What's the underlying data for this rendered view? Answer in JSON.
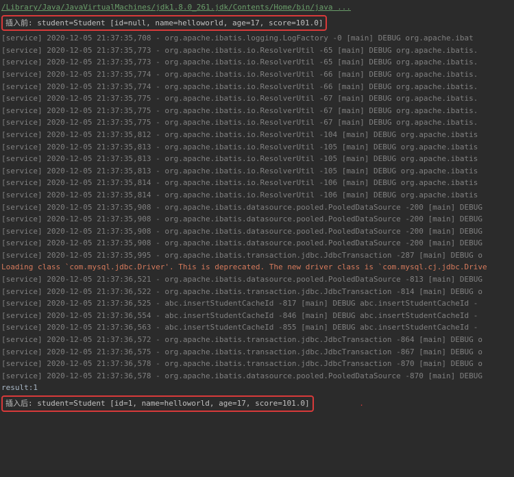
{
  "header": "/Library/Java/JavaVirtualMachines/jdk1.8.0_261.jdk/Contents/Home/bin/java ...",
  "before_insert": "插入前: student=Student [id=null, name=helloworld, age=17, score=101.0]",
  "after_insert": "插入后: student=Student [id=1, name=helloworld, age=17, score=101.0]",
  "result_text": "result:1",
  "red_dot": ".",
  "warning": "Loading class `com.mysql.jdbc.Driver'. This is deprecated. The new driver class is `com.mysql.cj.jdbc.Drive",
  "logs": [
    "[service] 2020-12-05 21:37:35,708 - org.apache.ibatis.logging.LogFactory -0    [main] DEBUG org.apache.ibat",
    "[service] 2020-12-05 21:37:35,773 - org.apache.ibatis.io.ResolverUtil -65   [main] DEBUG org.apache.ibatis.",
    "[service] 2020-12-05 21:37:35,773 - org.apache.ibatis.io.ResolverUtil -65   [main] DEBUG org.apache.ibatis.",
    "[service] 2020-12-05 21:37:35,774 - org.apache.ibatis.io.ResolverUtil -66   [main] DEBUG org.apache.ibatis.",
    "[service] 2020-12-05 21:37:35,774 - org.apache.ibatis.io.ResolverUtil -66   [main] DEBUG org.apache.ibatis.",
    "[service] 2020-12-05 21:37:35,775 - org.apache.ibatis.io.ResolverUtil -67   [main] DEBUG org.apache.ibatis.",
    "[service] 2020-12-05 21:37:35,775 - org.apache.ibatis.io.ResolverUtil -67   [main] DEBUG org.apache.ibatis.",
    "[service] 2020-12-05 21:37:35,775 - org.apache.ibatis.io.ResolverUtil -67   [main] DEBUG org.apache.ibatis.",
    "[service] 2020-12-05 21:37:35,812 - org.apache.ibatis.io.ResolverUtil -104   [main] DEBUG org.apache.ibatis",
    "[service] 2020-12-05 21:37:35,813 - org.apache.ibatis.io.ResolverUtil -105   [main] DEBUG org.apache.ibatis",
    "[service] 2020-12-05 21:37:35,813 - org.apache.ibatis.io.ResolverUtil -105   [main] DEBUG org.apache.ibatis",
    "[service] 2020-12-05 21:37:35,813 - org.apache.ibatis.io.ResolverUtil -105   [main] DEBUG org.apache.ibatis",
    "[service] 2020-12-05 21:37:35,814 - org.apache.ibatis.io.ResolverUtil -106   [main] DEBUG org.apache.ibatis",
    "[service] 2020-12-05 21:37:35,814 - org.apache.ibatis.io.ResolverUtil -106   [main] DEBUG org.apache.ibatis",
    "[service] 2020-12-05 21:37:35,908 - org.apache.ibatis.datasource.pooled.PooledDataSource -200   [main] DEBUG",
    "[service] 2020-12-05 21:37:35,908 - org.apache.ibatis.datasource.pooled.PooledDataSource -200   [main] DEBUG",
    "[service] 2020-12-05 21:37:35,908 - org.apache.ibatis.datasource.pooled.PooledDataSource -200   [main] DEBUG",
    "[service] 2020-12-05 21:37:35,908 - org.apache.ibatis.datasource.pooled.PooledDataSource -200   [main] DEBUG",
    "[service] 2020-12-05 21:37:35,995 - org.apache.ibatis.transaction.jdbc.JdbcTransaction -287   [main] DEBUG o"
  ],
  "logs2": [
    "[service] 2020-12-05 21:37:36,521 - org.apache.ibatis.datasource.pooled.PooledDataSource -813   [main] DEBUG",
    "[service] 2020-12-05 21:37:36,522 - org.apache.ibatis.transaction.jdbc.JdbcTransaction -814   [main] DEBUG o",
    "[service] 2020-12-05 21:37:36,525 - abc.insertStudentCacheId -817   [main] DEBUG abc.insertStudentCacheId  -",
    "[service] 2020-12-05 21:37:36,554 - abc.insertStudentCacheId -846   [main] DEBUG abc.insertStudentCacheId  -",
    "[service] 2020-12-05 21:37:36,563 - abc.insertStudentCacheId -855   [main] DEBUG abc.insertStudentCacheId  -",
    "[service] 2020-12-05 21:37:36,572 - org.apache.ibatis.transaction.jdbc.JdbcTransaction -864   [main] DEBUG o",
    "[service] 2020-12-05 21:37:36,575 - org.apache.ibatis.transaction.jdbc.JdbcTransaction -867   [main] DEBUG o",
    "[service] 2020-12-05 21:37:36,578 - org.apache.ibatis.transaction.jdbc.JdbcTransaction -870   [main] DEBUG o",
    "[service] 2020-12-05 21:37:36,578 - org.apache.ibatis.datasource.pooled.PooledDataSource -870   [main] DEBUG"
  ]
}
